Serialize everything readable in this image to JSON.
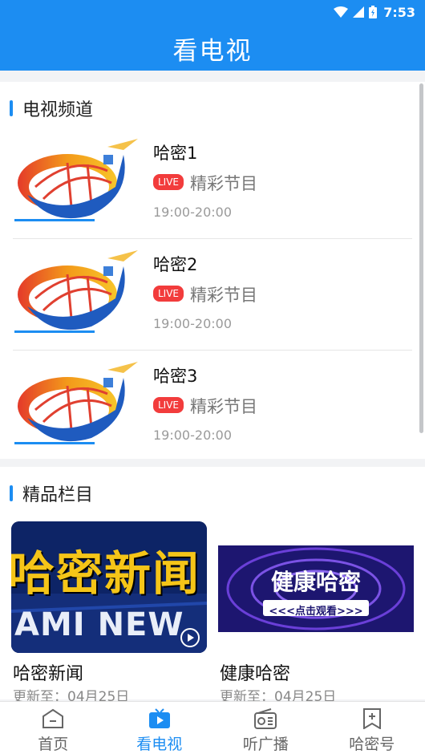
{
  "status_bar": {
    "time": "7:53"
  },
  "header": {
    "title": "看电视"
  },
  "channels_section": {
    "title": "电视频道",
    "items": [
      {
        "name": "哈密1",
        "badge": "LIVE",
        "program": "精彩节目",
        "time": "19:00-20:00"
      },
      {
        "name": "哈密2",
        "badge": "LIVE",
        "program": "精彩节目",
        "time": "19:00-20:00"
      },
      {
        "name": "哈密3",
        "badge": "LIVE",
        "program": "精彩节目",
        "time": "19:00-20:00"
      }
    ]
  },
  "columns_section": {
    "title": "精品栏目",
    "items": [
      {
        "title": "哈密新闻",
        "update": "更新至：04月25日",
        "thumb_text_top": "哈密新闻",
        "thumb_text_bottom": "AMI NEW"
      },
      {
        "title": "健康哈密",
        "update": "更新至：04月25日",
        "thumb_text_top": "健康哈密",
        "thumb_text_bottom": "<<<点击观看>>>"
      }
    ]
  },
  "bottom_nav": {
    "items": [
      {
        "label": "首页",
        "icon": "home-icon",
        "active": false
      },
      {
        "label": "看电视",
        "icon": "tv-icon",
        "active": true
      },
      {
        "label": "听广播",
        "icon": "radio-icon",
        "active": false
      },
      {
        "label": "哈密号",
        "icon": "bookmark-plus-icon",
        "active": false
      }
    ]
  },
  "colors": {
    "primary": "#1c8df2",
    "live": "#f23c3c"
  }
}
